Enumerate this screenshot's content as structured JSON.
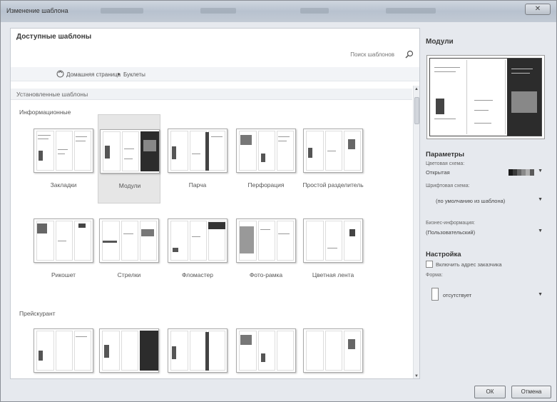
{
  "window": {
    "title": "Изменение шаблона",
    "close_label": "✕"
  },
  "left": {
    "heading": "Доступные шаблоны",
    "search_placeholder": "Поиск шаблонов",
    "breadcrumb": {
      "home": "Домашняя страница",
      "separator": "▸",
      "current": "Буклеты"
    },
    "installed_header": "Установленные шаблоны",
    "groups": [
      {
        "name": "Информационные",
        "tiles": [
          "Закладки",
          "Модули",
          "Парча",
          "Перфорация",
          "Простой разделитель",
          "Рикошет",
          "Стрелки",
          "Фломастер",
          "Фото-рамка",
          "Цветная лента"
        ]
      },
      {
        "name": "Прейскурант"
      }
    ],
    "selected_tile": "Модули"
  },
  "right": {
    "title": "Модули",
    "params_header": "Параметры",
    "color_scheme_label": "Цветовая схема:",
    "color_scheme_value": "Открытая",
    "color_scheme_swatch": [
      "#1a1a1a",
      "#3a3a3a",
      "#666666",
      "#8a8a8a",
      "#b0b0b0",
      "#5a5a5a"
    ],
    "font_scheme_label": "Шрифтовая схема:",
    "font_scheme_value": "(по умолчанию из шаблона)",
    "business_label": "Бизнес-информация:",
    "business_value": "(Пользовательский)",
    "setup_header": "Настройка",
    "include_address_label": "Включить адрес заказчика",
    "include_address_checked": false,
    "form_label": "Форма:",
    "form_value": "отсутствует"
  },
  "footer": {
    "ok": "ОК",
    "cancel": "Отмена"
  },
  "colors": {
    "selected_tile_bg": "#e6e6e6",
    "panel_bg": "#ffffff",
    "frame_bg": "#e6e9ee"
  }
}
